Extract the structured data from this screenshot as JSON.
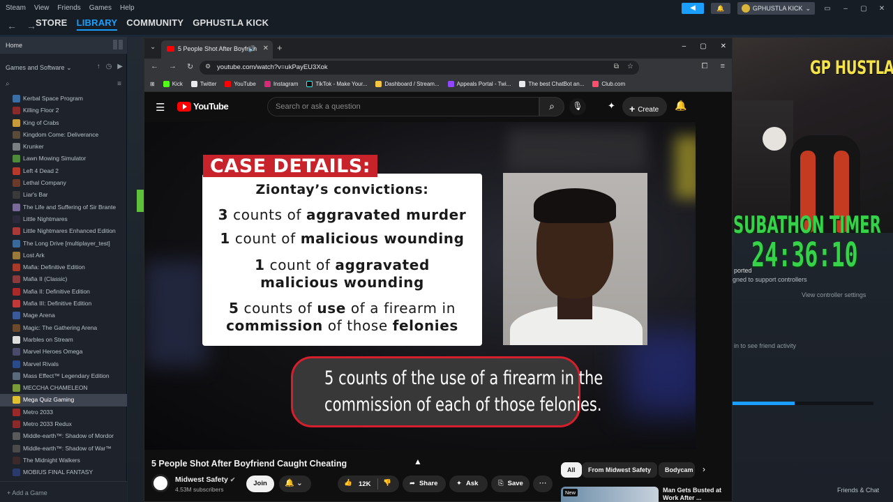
{
  "steam": {
    "menu": [
      "Steam",
      "View",
      "Friends",
      "Games",
      "Help"
    ],
    "user_name": "GPHUSTLA KICK",
    "nav_links": [
      "STORE",
      "LIBRARY",
      "COMMUNITY",
      "GPHUSTLA KICK"
    ],
    "home": "Home",
    "filter": "Games and Software",
    "games": [
      "Kerbal Space Program",
      "Killing Floor 2",
      "King of Crabs",
      "Kingdom Come: Deliverance",
      "Krunker",
      "Lawn Mowing Simulator",
      "Left 4 Dead 2",
      "Lethal Company",
      "Liar's Bar",
      "The Life and Suffering of Sir Brante",
      "Little Nightmares",
      "Little Nightmares Enhanced Edition",
      "The Long Drive [multiplayer_test]",
      "Lost Ark",
      "Mafia: Definitive Edition",
      "Mafia II (Classic)",
      "Mafia II: Definitive Edition",
      "Mafia III: Definitive Edition",
      "Mage Arena",
      "Magic: The Gathering Arena",
      "Marbles on Stream",
      "Marvel Heroes Omega",
      "Marvel Rivals",
      "Mass Effect™ Legendary Edition",
      "MECCHA CHAMELEON",
      "Mega Quiz Gaming",
      "Metro 2033",
      "Metro 2033 Redux",
      "Middle-earth™: Shadow of Mordor",
      "Middle-earth™: Shadow of War™",
      "The Midnight Walkers",
      "MOBIUS FINAL FANTASY"
    ],
    "selected_game": "Mega Quiz Gaming",
    "add_game": "Add a Game",
    "friends_chat": "Friends & Chat",
    "bg_text": [
      "ported",
      "igned to support controllers",
      "View controller settings",
      "in to see friend activity"
    ],
    "download_progress": 0.44
  },
  "overlay": {
    "cam_title": "GP HUSTLA",
    "subathon_label": "SUBATHON TIMER",
    "timer": "24:36:10"
  },
  "browser": {
    "tab_title": "5 People Shot After Boyfrien",
    "url": "youtube.com/watch?v=ukPayEU3Xok",
    "bookmarks": [
      "Kick",
      "Twitter",
      "YouTube",
      "Instagram",
      "TikTok - Make Your...",
      "Dashboard / Stream...",
      "Appeals Portal - Twi...",
      "The best ChatBot an...",
      "Club.com"
    ]
  },
  "youtube": {
    "logo": "YouTube",
    "search_placeholder": "Search or ask a question",
    "create": "Create",
    "video": {
      "case_tag": "CASE DETAILS:",
      "heading": "Ziontay’s convictions:",
      "lines": [
        {
          "pre": "3",
          "mid": " counts of ",
          "post": "aggravated murder",
          "tail": ""
        },
        {
          "pre": "1",
          "mid": " count of ",
          "post": "malicious wounding",
          "tail": ""
        },
        {
          "pre": "1",
          "mid": " count of ",
          "post": "aggravated",
          "tail": ""
        },
        {
          "pre": "",
          "mid": "",
          "post": "malicious wounding",
          "tail": ""
        },
        {
          "pre": "5",
          "mid": " counts of ",
          "post": "use",
          "tail": " of a firearm in"
        },
        {
          "pre": "commission",
          "mid": " of those ",
          "post": "felonies",
          "tail": ""
        }
      ],
      "caption_line1": "5 counts of the use of a firearm in the",
      "caption_line2": "commission of each of those felonies."
    },
    "title": "5 People Shot After Boyfriend Caught Cheating",
    "channel": "Midwest Safety",
    "subscribers": "4.53M subscribers",
    "join": "Join",
    "likes": "12K",
    "share": "Share",
    "ask": "Ask",
    "save": "Save",
    "chips": [
      "All",
      "From Midwest Safety",
      "Bodycam"
    ],
    "rec_badge": "New",
    "rec_title": "Man Gets Busted at Work After ..."
  }
}
